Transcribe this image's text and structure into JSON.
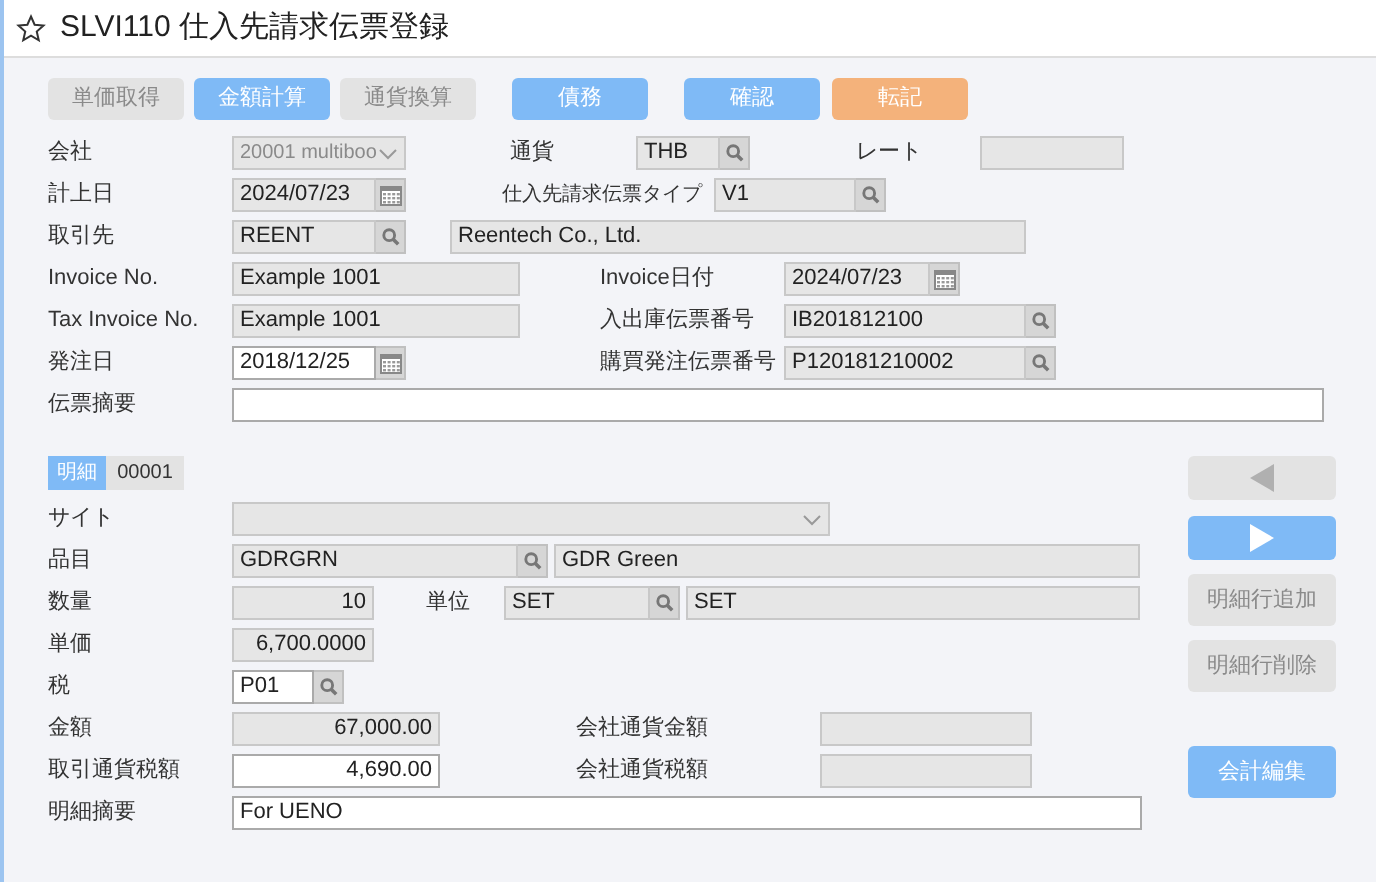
{
  "title": "SLVI110 仕入先請求伝票登録",
  "toolbar": [
    {
      "label": "単価取得",
      "kind": "secondary"
    },
    {
      "label": "金額計算",
      "kind": "primary"
    },
    {
      "label": "通貨換算",
      "kind": "secondary"
    },
    {
      "label": "債務",
      "kind": "primary"
    },
    {
      "label": "確認",
      "kind": "primary"
    },
    {
      "label": "転記",
      "kind": "warning"
    }
  ],
  "header": {
    "company": {
      "label": "会社",
      "value": "20001 multiboo",
      "editable": false,
      "kind": "select"
    },
    "currency": {
      "label": "通貨",
      "value": "THB",
      "editable": false,
      "kind": "search"
    },
    "rate": {
      "label": "レート",
      "editable": false
    },
    "posting_date": {
      "label": "計上日",
      "value": "2024/07/23",
      "editable": false,
      "kind": "calendar"
    },
    "invoice_type": {
      "label": "仕入先請求伝票タイプ",
      "value": "V1",
      "editable": false,
      "kind": "search"
    },
    "vendor": {
      "label": "取引先",
      "value": "REENT",
      "editable": false,
      "kind": "search"
    },
    "vendor_name": {
      "value": "Reentech Co., Ltd.",
      "editable": false
    },
    "invoice_no": {
      "label": "Invoice No.",
      "value": "Example 1001",
      "editable": false
    },
    "invoice_date": {
      "label": "Invoice日付",
      "value": "2024/07/23",
      "editable": false,
      "kind": "calendar"
    },
    "tax_invoice_no": {
      "label": "Tax Invoice No.",
      "value": "Example 1001",
      "editable": false
    },
    "receipt_no": {
      "label": "入出庫伝票番号",
      "value": "IB201812100",
      "editable": false,
      "kind": "search"
    },
    "order_date": {
      "label": "発注日",
      "value": "2018/12/25",
      "editable": true,
      "kind": "calendar"
    },
    "po_no": {
      "label": "購買発注伝票番号",
      "value": "P120181210002",
      "editable": false,
      "kind": "search"
    },
    "memo": {
      "label": "伝票摘要",
      "editable": true
    }
  },
  "detail_tabs": [
    {
      "label": "明細",
      "selected": true
    },
    {
      "label": "00001",
      "selected": false
    }
  ],
  "detail": {
    "site": {
      "label": "サイト",
      "editable": false,
      "kind": "select"
    },
    "item": {
      "label": "品目",
      "value": "GDRGRN",
      "editable": false,
      "kind": "search"
    },
    "item_name": {
      "value": "GDR Green",
      "editable": false
    },
    "quantity": {
      "label": "数量",
      "value": "10",
      "editable": false
    },
    "unit": {
      "label": "単位",
      "value": "SET",
      "editable": false,
      "kind": "search"
    },
    "unit_name": {
      "value": "SET",
      "editable": false
    },
    "unit_price": {
      "label": "単価",
      "value": "6,700.0000",
      "editable": false
    },
    "tax": {
      "label": "税",
      "value": "P01",
      "editable": true,
      "kind": "search"
    },
    "amount": {
      "label": "金額",
      "value": "67,000.00",
      "editable": false
    },
    "company_amount": {
      "label": "会社通貨金額",
      "editable": false
    },
    "tax_amount": {
      "label": "取引通貨税額",
      "value": "4,690.00",
      "editable": true
    },
    "company_tax_amount": {
      "label": "会社通貨税額",
      "editable": false
    },
    "line_memo": {
      "label": "明細摘要",
      "value": "For UENO",
      "editable": true
    }
  },
  "side_buttons": [
    {
      "kind": "prev"
    },
    {
      "kind": "next"
    },
    {
      "label": "明細行追加",
      "kind": "secondary"
    },
    {
      "label": "明細行削除",
      "kind": "secondary"
    },
    {
      "label": "会計編集",
      "kind": "primary"
    }
  ]
}
